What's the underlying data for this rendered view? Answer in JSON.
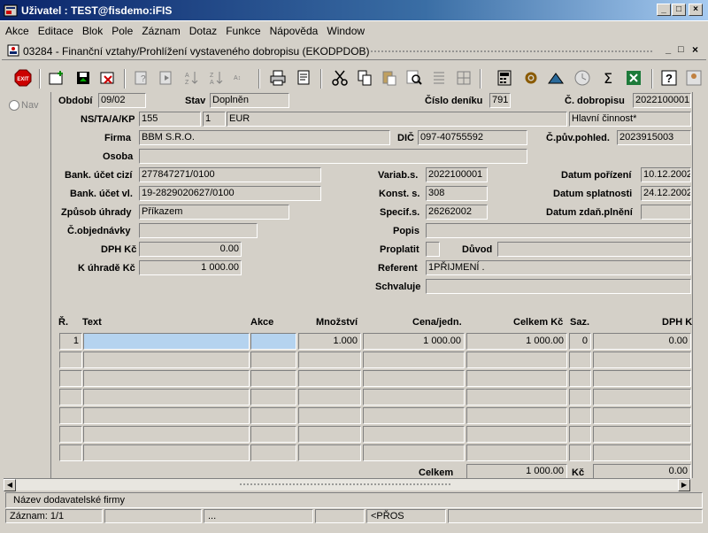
{
  "window": {
    "title": "Uživatel : TEST@fisdemo:iFIS",
    "controls": {
      "minimize": "_",
      "maximize": "□",
      "close": "×"
    }
  },
  "menu": [
    "Akce",
    "Editace",
    "Blok",
    "Pole",
    "Záznam",
    "Dotaz",
    "Funkce",
    "Nápověda",
    "Window"
  ],
  "form_title": "03284 - Finanční vztahy/Prohlížení vystaveného dobropisu (EKODPDOB)",
  "inner_controls": {
    "minimize": "_",
    "maximize": "□",
    "close": "×"
  },
  "nav": {
    "label": "Nav"
  },
  "labels": {
    "obdobi": "Období",
    "stav": "Stav",
    "cislo_deniku": "Číslo deníku",
    "c_dobropisu": "Č. dobropisu",
    "ns": "NS/TA/A/KP",
    "firma": "Firma",
    "dic": "DIČ",
    "c_puv_pohled": "Č.pův.pohled.",
    "osoba": "Osoba",
    "bank_cizi": "Bank. účet cizí",
    "variab": "Variab.s.",
    "datum_porizeni": "Datum pořízení",
    "bank_vl": "Bank. účet vl.",
    "konst": "Konst. s.",
    "datum_splatnosti": "Datum splatnosti",
    "zpusob": "Způsob úhrady",
    "specif": "Specif.s.",
    "datum_zdan": "Datum zdaň.plnění",
    "objednavky": "Č.objednávky",
    "popis": "Popis",
    "dph": "DPH Kč",
    "proplatit": "Proplatit",
    "duvod": "Důvod",
    "k_uhrade": "K úhradě Kč",
    "referent": "Referent",
    "schvaluje": "Schvaluje"
  },
  "fields": {
    "obdobi": "09/02",
    "stav": "Doplněn",
    "cislo_deniku": "791",
    "c_dobropisu": "2022100001",
    "ns1": "155",
    "ns2": "1",
    "ns3": "EUR",
    "ns4": "Hlavní činnost*",
    "firma": "BBM S.R.O.",
    "dic": "097-40755592",
    "c_puv_pohled": "2023915003",
    "osoba": "",
    "bank_cizi": "277847271/0100",
    "variab": "2022100001",
    "datum_porizeni": "10.12.2002",
    "bank_vl": "19-2829020627/0100",
    "konst": "308",
    "datum_splatnosti": "24.12.2002",
    "zpusob": "Příkazem",
    "specif": "26262002",
    "datum_zdan": "",
    "objednavky": "",
    "popis": "",
    "dph": "0.00",
    "proplatit": "",
    "duvod": "",
    "k_uhrade": "1 000.00",
    "referent": "1PŘIJMENÍ .",
    "schvaluje": ""
  },
  "grid": {
    "headers": {
      "r": "Ř.",
      "text": "Text",
      "akce": "Akce",
      "mnozstvi": "Množství",
      "cena": "Cena/jedn.",
      "celkem": "Celkem Kč",
      "saz": "Saz.",
      "dph": "DPH Kč"
    },
    "rows": [
      {
        "r": "1",
        "text": "",
        "akce": "",
        "mnozstvi": "1.000",
        "cena": "1 000.00",
        "celkem": "1 000.00",
        "saz": "0",
        "dph": "0.00"
      },
      {
        "r": "",
        "text": "",
        "akce": "",
        "mnozstvi": "",
        "cena": "",
        "celkem": "",
        "saz": "",
        "dph": ""
      },
      {
        "r": "",
        "text": "",
        "akce": "",
        "mnozstvi": "",
        "cena": "",
        "celkem": "",
        "saz": "",
        "dph": ""
      },
      {
        "r": "",
        "text": "",
        "akce": "",
        "mnozstvi": "",
        "cena": "",
        "celkem": "",
        "saz": "",
        "dph": ""
      },
      {
        "r": "",
        "text": "",
        "akce": "",
        "mnozstvi": "",
        "cena": "",
        "celkem": "",
        "saz": "",
        "dph": ""
      },
      {
        "r": "",
        "text": "",
        "akce": "",
        "mnozstvi": "",
        "cena": "",
        "celkem": "",
        "saz": "",
        "dph": ""
      },
      {
        "r": "",
        "text": "",
        "akce": "",
        "mnozstvi": "",
        "cena": "",
        "celkem": "",
        "saz": "",
        "dph": ""
      }
    ],
    "footer": {
      "label": "Celkem",
      "celkem": "1 000.00",
      "kc_label": "Kč",
      "dph": "0.00"
    }
  },
  "status": {
    "message": "Název dodavatelské firmy",
    "record": "Záznam: 1/1",
    "ellipsis": "...",
    "mode": "<PŘOS"
  },
  "colors": {
    "selected_row": "#b5d3ef",
    "title_start": "#0a246a",
    "title_end": "#a6caf0"
  }
}
